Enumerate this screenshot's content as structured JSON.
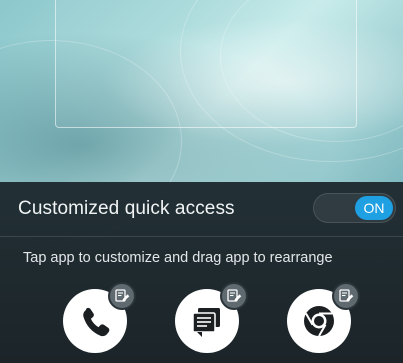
{
  "quick_access": {
    "title": "Customized quick access",
    "toggle_state": "ON"
  },
  "hint_text": "Tap app to customize and drag app to rearrange",
  "apps": [
    {
      "icon": "phone-icon"
    },
    {
      "icon": "messaging-icon"
    },
    {
      "icon": "chrome-icon"
    }
  ],
  "colors": {
    "toggle_on": "#1ea0e2",
    "panel_bg": "#223036",
    "app_circle": "#ffffff"
  }
}
